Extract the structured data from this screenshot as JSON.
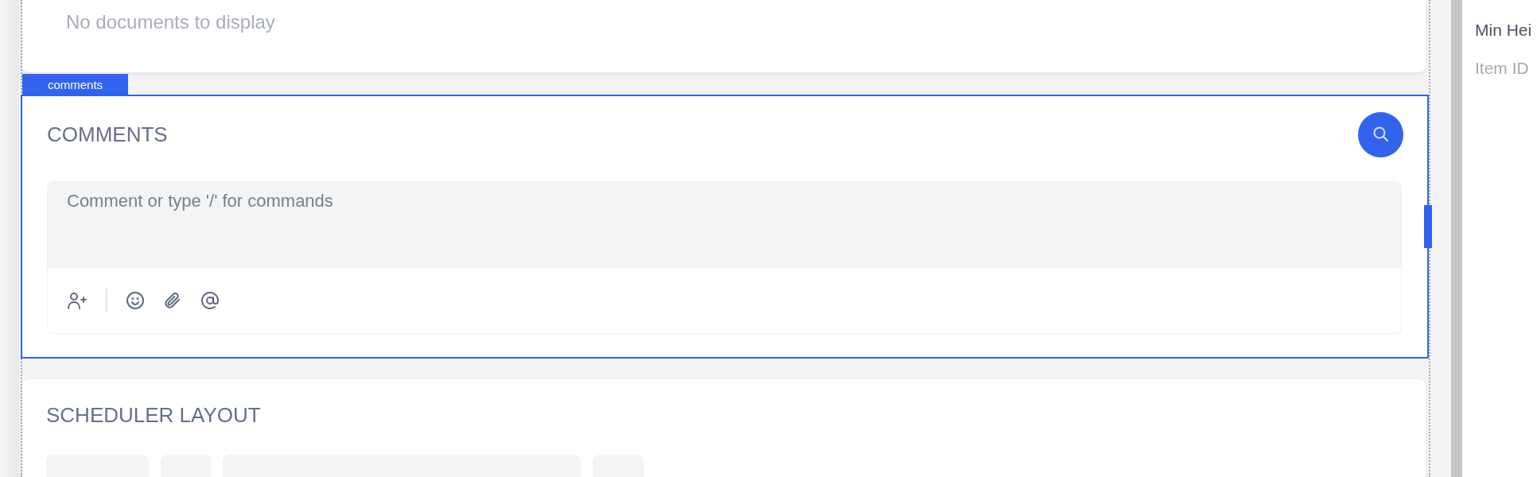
{
  "documents_card": {
    "empty_text": "No documents to display"
  },
  "comments_widget": {
    "tag": "comments",
    "selected": true,
    "title": "COMMENTS",
    "editor": {
      "placeholder": "Comment or type '/' for commands"
    }
  },
  "scheduler_card": {
    "title": "SCHEDULER LAYOUT"
  },
  "properties_panel": {
    "fields": [
      {
        "label": "Min Hei",
        "kind": "label"
      },
      {
        "label": "Item ID",
        "kind": "hint"
      }
    ]
  }
}
